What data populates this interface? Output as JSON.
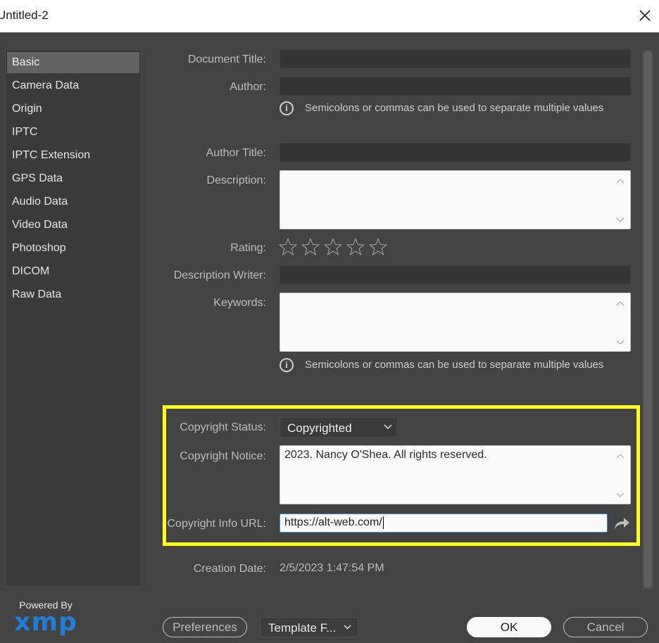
{
  "window": {
    "title": "Untitled-2"
  },
  "sidebar": {
    "items": [
      {
        "label": "Basic",
        "active": true
      },
      {
        "label": "Camera Data"
      },
      {
        "label": "Origin"
      },
      {
        "label": "IPTC"
      },
      {
        "label": "IPTC Extension"
      },
      {
        "label": "GPS Data"
      },
      {
        "label": "Audio Data"
      },
      {
        "label": "Video Data"
      },
      {
        "label": "Photoshop"
      },
      {
        "label": "DICOM"
      },
      {
        "label": "Raw Data"
      }
    ]
  },
  "form": {
    "document_title": {
      "label": "Document Title:",
      "value": ""
    },
    "author": {
      "label": "Author:",
      "value": ""
    },
    "author_hint": "Semicolons or commas can be used to separate multiple values",
    "author_title": {
      "label": "Author Title:",
      "value": ""
    },
    "description": {
      "label": "Description:",
      "value": ""
    },
    "rating": {
      "label": "Rating:",
      "value": 0,
      "max": 5
    },
    "description_writer": {
      "label": "Description Writer:",
      "value": ""
    },
    "keywords": {
      "label": "Keywords:",
      "value": ""
    },
    "keywords_hint": "Semicolons or commas can be used to separate multiple values",
    "copyright_status": {
      "label": "Copyright Status:",
      "value": "Copyrighted"
    },
    "copyright_notice": {
      "label": "Copyright Notice:",
      "value": "2023. Nancy O'Shea. All rights reserved."
    },
    "copyright_url": {
      "label": "Copyright Info URL:",
      "value": "https://alt-web.com/"
    },
    "creation_date": {
      "label": "Creation Date:",
      "value": "2/5/2023 1:47:54 PM"
    }
  },
  "footer": {
    "powered_by": "Powered By",
    "logo": "xmp",
    "preferences": "Preferences",
    "template": "Template F...",
    "ok": "OK",
    "cancel": "Cancel"
  },
  "colors": {
    "highlight": "#ffff1e",
    "accent": "#1f7fd8",
    "background": "#434343"
  }
}
